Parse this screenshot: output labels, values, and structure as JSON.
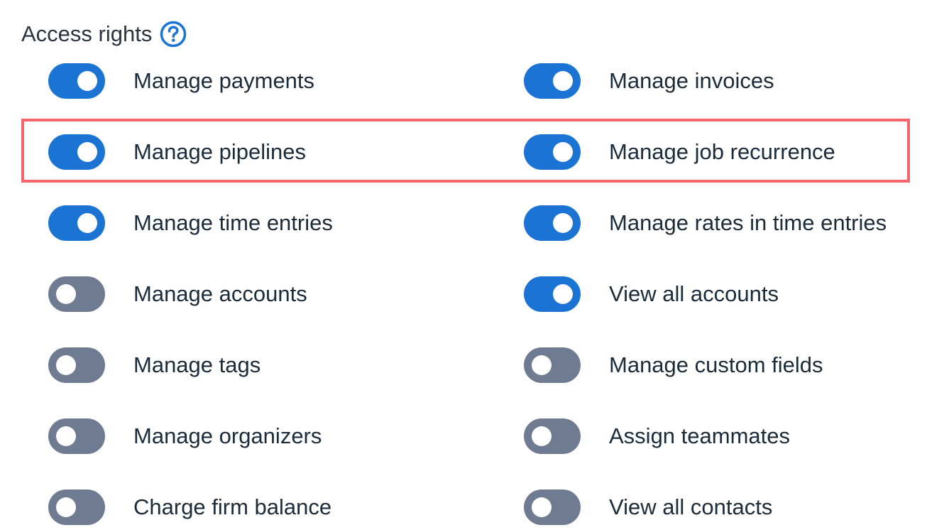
{
  "section": {
    "title": "Access rights",
    "help_icon": "question-circle-icon"
  },
  "colors": {
    "toggle_on": "#1b74d4",
    "toggle_off": "#6e7b91",
    "highlight": "#f4666a",
    "text": "#1c2b3a"
  },
  "rows": [
    {
      "left": {
        "label": "Manage payments",
        "enabled": true
      },
      "right": {
        "label": "Manage invoices",
        "enabled": true
      }
    },
    {
      "left": {
        "label": "Manage pipelines",
        "enabled": true
      },
      "right": {
        "label": "Manage job recurrence",
        "enabled": true
      },
      "highlighted": true
    },
    {
      "left": {
        "label": "Manage time entries",
        "enabled": true
      },
      "right": {
        "label": "Manage rates in time entries",
        "enabled": true
      }
    },
    {
      "left": {
        "label": "Manage accounts",
        "enabled": false
      },
      "right": {
        "label": "View all accounts",
        "enabled": true
      }
    },
    {
      "left": {
        "label": "Manage tags",
        "enabled": false
      },
      "right": {
        "label": "Manage custom fields",
        "enabled": false
      }
    },
    {
      "left": {
        "label": "Manage organizers",
        "enabled": false
      },
      "right": {
        "label": "Assign teammates",
        "enabled": false
      }
    },
    {
      "left": {
        "label": "Charge firm balance",
        "enabled": false
      },
      "right": {
        "label": "View all contacts",
        "enabled": false
      }
    }
  ]
}
